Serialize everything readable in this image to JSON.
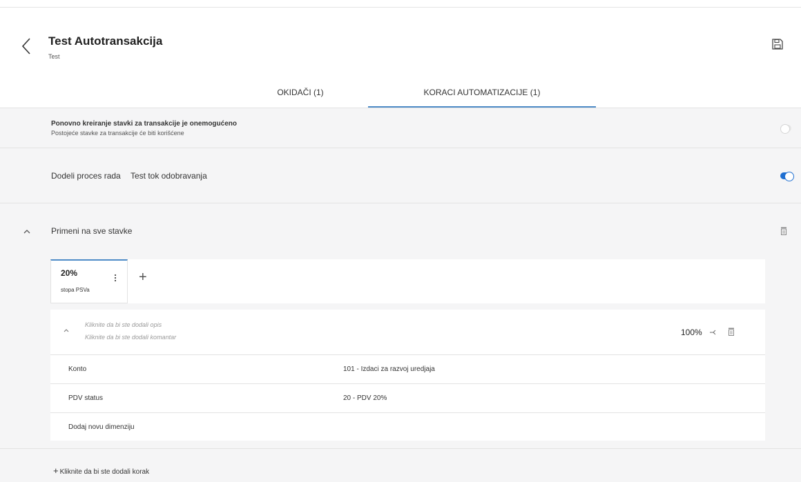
{
  "header": {
    "title": "Test Autotransakcija",
    "subtitle": "Test"
  },
  "tabs": [
    {
      "label": "OKIDAČI (1)",
      "active": false
    },
    {
      "label": "KORACI AUTOMATIZACIJE (1)",
      "active": true
    }
  ],
  "recreate": {
    "title": "Ponovno kreiranje stavki za transakcije je onemogućeno",
    "subtitle": "Postojeće stavke za transakcije će biti korišćene",
    "enabled": false
  },
  "workflow": {
    "label": "Dodeli proces rada",
    "value": "Test tok odobravanja",
    "enabled": true
  },
  "step": {
    "label": "Primeni na sve stavke",
    "rate": {
      "value": "20%",
      "name": "stopa PSVa"
    },
    "add_symbol": "+",
    "line": {
      "description_placeholder": "Kliknite da bi ste dodali opis",
      "comment_placeholder": "Kliknite da bi ste dodali komantar",
      "percent": "100%"
    },
    "dimensions": [
      {
        "label": "Konto",
        "value": "101 - Izdaci za razvoj uredjaja"
      },
      {
        "label": "PDV status",
        "value": "20 - PDV 20%"
      }
    ],
    "add_dimension_label": "Dodaj novu dimenziju"
  },
  "add_step_label": "Kliknite da bi ste dodali korak",
  "colors": {
    "accent": "#1f6fd1",
    "tab_underline": "#4d8bc7",
    "background": "#f5f5f6"
  },
  "icons": [
    "back-arrow-icon",
    "save-icon",
    "chevron-up-icon",
    "trash-icon",
    "kebab-menu-icon",
    "plus-icon",
    "split-icon"
  ]
}
